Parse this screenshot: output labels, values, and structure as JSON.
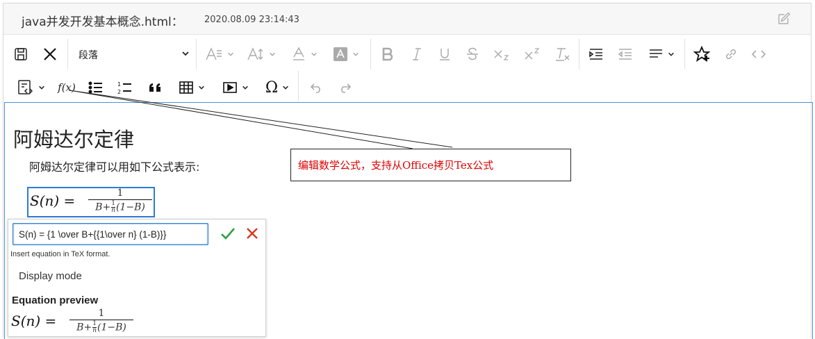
{
  "title": {
    "filename": "java并发开发基本概念.html",
    "separator": "：",
    "timestamp": "2020.08.09 23:14:43"
  },
  "toolbar": {
    "paragraph_style": "段落",
    "icons": [
      "save-icon",
      "close-icon",
      "font-family-icon",
      "font-size-icon",
      "font-color-icon",
      "highlight-color-icon",
      "bold-icon",
      "italic-icon",
      "underline-icon",
      "strikethrough-icon",
      "subscript-icon",
      "superscript-icon",
      "clear-format-icon",
      "indent-icon",
      "outdent-icon",
      "align-icon",
      "favorite-icon",
      "link-icon",
      "code-icon",
      "template-icon",
      "formula-icon",
      "bullet-list-icon",
      "numbered-list-icon",
      "blockquote-icon",
      "table-icon",
      "media-icon",
      "special-char-icon",
      "undo-icon",
      "redo-icon"
    ],
    "formula_label": "f(x)"
  },
  "document": {
    "heading": "阿姆达尔定律",
    "paragraph": "阿姆达尔定律可以用如下公式表示:",
    "equation": {
      "lhs": "S(n) = ",
      "numerator": "1",
      "den_prefix": "B+",
      "den_frac_num": "1",
      "den_frac_den": "n",
      "den_suffix": "(1−B)"
    }
  },
  "equation_editor": {
    "tex_value": "S(n) = {1 \\over B+{{1\\over n} (1-B)}}",
    "hint": "Insert equation in TeX format.",
    "display_mode_label": "Display mode",
    "preview_label": "Equation preview"
  },
  "callout": {
    "text": "编辑数学公式，支持从Office拷贝Tex公式",
    "color": "#e00000"
  }
}
